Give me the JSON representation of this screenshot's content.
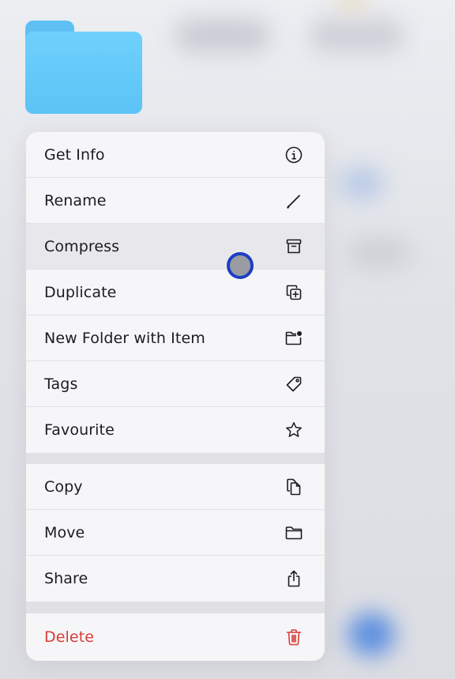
{
  "menu": {
    "items": [
      {
        "label": "Get Info",
        "icon": "info-circle-icon"
      },
      {
        "label": "Rename",
        "icon": "pencil-icon"
      },
      {
        "label": "Compress",
        "icon": "archive-box-icon"
      },
      {
        "label": "Duplicate",
        "icon": "duplicate-plus-icon"
      },
      {
        "label": "New Folder with Item",
        "icon": "folder-badge-plus-icon"
      },
      {
        "label": "Tags",
        "icon": "tag-icon"
      },
      {
        "label": "Favourite",
        "icon": "star-icon"
      },
      {
        "label": "Copy",
        "icon": "copy-doc-icon"
      },
      {
        "label": "Move",
        "icon": "folder-icon"
      },
      {
        "label": "Share",
        "icon": "share-icon"
      },
      {
        "label": "Delete",
        "icon": "trash-icon"
      }
    ],
    "highlighted_item": "Compress"
  },
  "colors": {
    "folder": "#5bc4f6",
    "destructive": "#d93c37",
    "touch_indicator_ring": "#1d3ec5"
  }
}
